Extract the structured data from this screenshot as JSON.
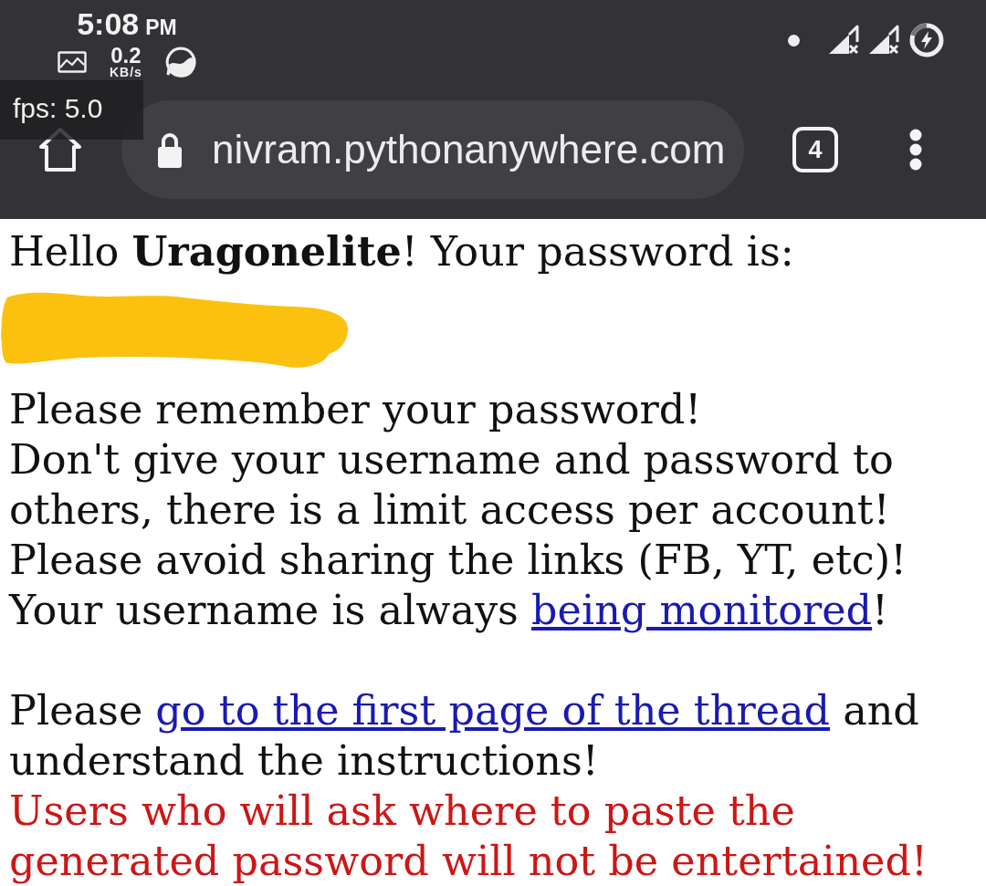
{
  "status_bar": {
    "time": "5:08",
    "meridiem": "PM",
    "data_rate": "0.2",
    "data_unit": "KB/s"
  },
  "fps_overlay": {
    "text": "fps: 5.0"
  },
  "browser_toolbar": {
    "url": "nivram.pythonanywhere.com",
    "secure": true,
    "tab_count": "4"
  },
  "page": {
    "paragraphs": [
      {
        "lines": [
          {
            "kind": "plain",
            "parts": [
              {
                "kind": "text",
                "text": "Hello **Uragonelite**! Your password is:"
              }
            ]
          },
          {
            "kind": "redacted"
          }
        ]
      },
      {
        "lines": [
          {
            "kind": "plain",
            "parts": [
              {
                "kind": "text",
                "text": "Please remember your password!"
              }
            ]
          },
          {
            "kind": "plain",
            "parts": [
              {
                "kind": "text",
                "text": "Don't give your username and password to others, there is a limit access per account!"
              }
            ]
          },
          {
            "kind": "plain",
            "parts": [
              {
                "kind": "text",
                "text": "Please avoid sharing the links (FB, YT, etc)!"
              }
            ]
          },
          {
            "kind": "plain",
            "parts": [
              {
                "kind": "text",
                "text": "Your username is always "
              },
              {
                "kind": "link",
                "text": "being monitored"
              },
              {
                "kind": "text",
                "text": "!"
              }
            ]
          }
        ]
      },
      {
        "lines": [
          {
            "kind": "plain",
            "parts": [
              {
                "kind": "text",
                "text": "Please "
              },
              {
                "kind": "link",
                "text": "go to the first page of the thread"
              },
              {
                "kind": "text",
                "text": " and understand the instructions!"
              }
            ]
          },
          {
            "kind": "warning",
            "parts": [
              {
                "kind": "text",
                "text": "Users who will ask where to paste the generated password will not be entertained!"
              }
            ]
          }
        ]
      }
    ]
  }
}
